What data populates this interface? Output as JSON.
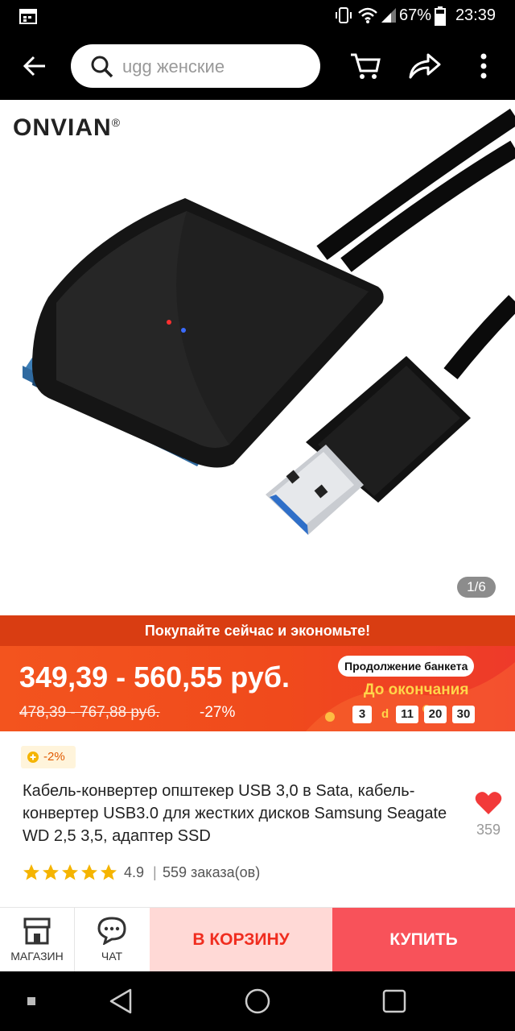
{
  "status_bar": {
    "battery_percent": "67%",
    "time": "23:39",
    "icons": [
      "calendar-icon",
      "vibrate-icon",
      "wifi-icon",
      "signal-icon",
      "battery-icon"
    ]
  },
  "top_bar": {
    "search_placeholder": "ugg женские",
    "icons": [
      "back-arrow-icon",
      "search-icon",
      "cart-icon",
      "share-icon",
      "more-vert-icon"
    ]
  },
  "gallery": {
    "brand": "ONVIAN",
    "brand_mark": "®",
    "counter": "1/6"
  },
  "promo": {
    "headline": "Покупайте сейчас и экономьте!",
    "price_range": "349,39 - 560,55 руб.",
    "old_price_range": "478,39 - 767,88 руб.",
    "discount": "-27%",
    "event_label": "Продолжение банкета",
    "countdown_label": "До окончания",
    "countdown": {
      "days": "3",
      "days_unit": "d",
      "hours": "11",
      "minutes": "20",
      "seconds": "30"
    },
    "colors": {
      "banner": "#f3541e",
      "headline_bg": "#d93d12",
      "accent": "#ffd64a"
    }
  },
  "product": {
    "coupon_badge": "-2%",
    "title": "Кабель-конвертер општекер USB 3,0 в Sata, кабель-конвертер USB3.0 для жестких дисков Samsung Seagate WD 2,5 3,5, адаптер SSD",
    "wishlist_count": "359",
    "rating": "4.9",
    "stars": 5,
    "orders": "559 заказа(ов)"
  },
  "actions": {
    "store_label": "МАГАЗИН",
    "chat_label": "ЧАТ",
    "add_to_cart_label": "В КОРЗИНУ",
    "buy_label": "КУПИТЬ",
    "colors": {
      "cart_bg": "#ffd9d6",
      "cart_text": "#f02d1f",
      "buy_bg": "#f8525a"
    }
  },
  "nav_bar": {
    "icons": [
      "recent-dot-icon",
      "back-triangle-icon",
      "home-circle-icon",
      "overview-square-icon"
    ]
  }
}
